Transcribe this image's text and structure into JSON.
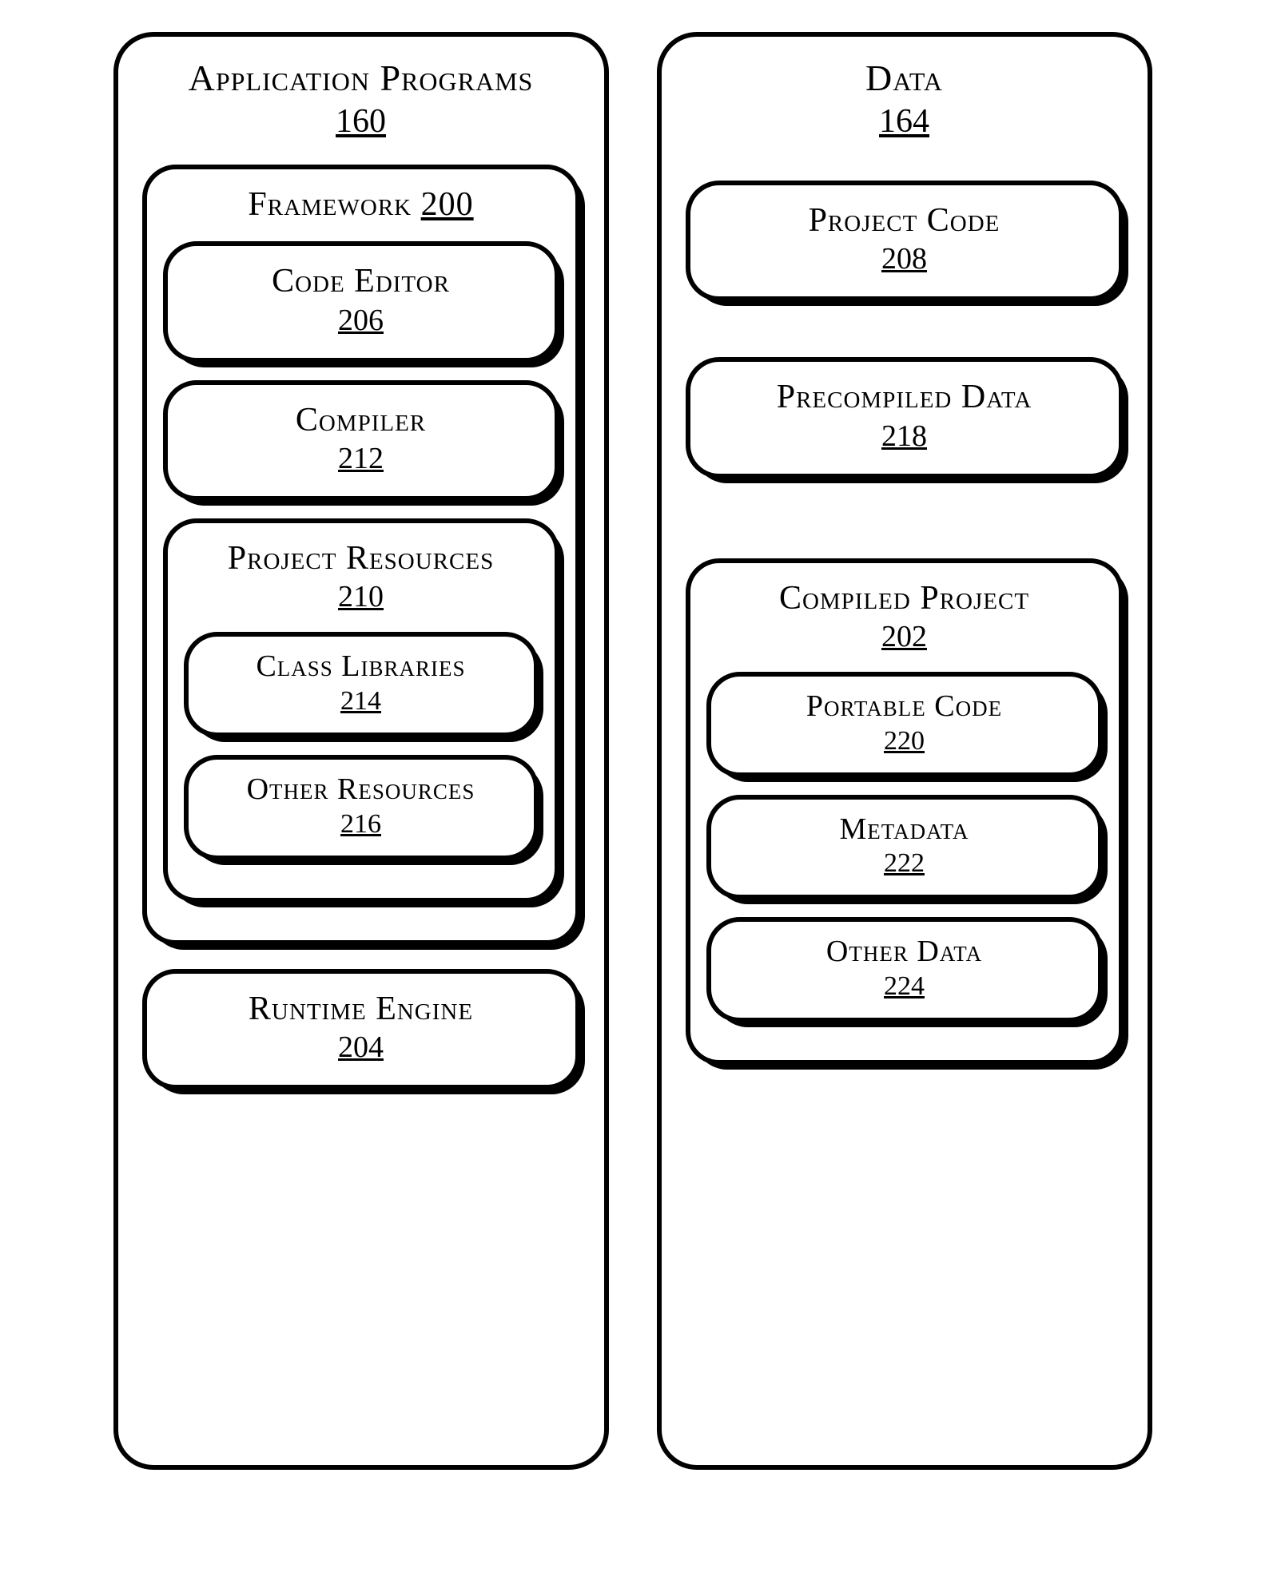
{
  "left": {
    "title": "Application Programs",
    "ref": "160",
    "framework": {
      "title": "Framework",
      "ref": "200",
      "code_editor": {
        "title": "Code Editor",
        "ref": "206"
      },
      "compiler": {
        "title": "Compiler",
        "ref": "212"
      },
      "project_resources": {
        "title": "Project Resources",
        "ref": "210",
        "class_libraries": {
          "title": "Class Libraries",
          "ref": "214"
        },
        "other_resources": {
          "title": "Other Resources",
          "ref": "216"
        }
      }
    },
    "runtime_engine": {
      "title": "Runtime Engine",
      "ref": "204"
    }
  },
  "right": {
    "title": "Data",
    "ref": "164",
    "project_code": {
      "title": "Project Code",
      "ref": "208"
    },
    "precompiled_data": {
      "title": "Precompiled Data",
      "ref": "218"
    },
    "compiled_project": {
      "title": "Compiled Project",
      "ref": "202",
      "portable_code": {
        "title": "Portable Code",
        "ref": "220"
      },
      "metadata": {
        "title": "Metadata",
        "ref": "222"
      },
      "other_data": {
        "title": "Other Data",
        "ref": "224"
      }
    }
  }
}
